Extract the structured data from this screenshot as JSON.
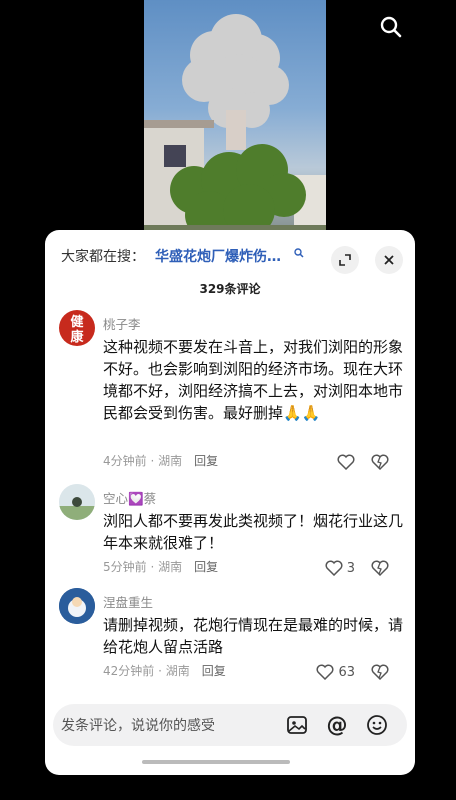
{
  "search_suggest": {
    "prefix": "大家都在搜：",
    "query": "华盛花炮厂爆炸伤…"
  },
  "comment_count": "329条评论",
  "comments": [
    {
      "user": "桃子李",
      "avatar_text": "健康",
      "text": "这种视频不要发在斗音上，对我们浏阳的形象不好。也会影响到浏阳的经济市场。现在大环境都不好，浏阳经济搞不上去，对浏阳本地市民都会受到伤害。最好删掉🙏🙏",
      "time": "4分钟前",
      "location": "湖南",
      "reply": "回复",
      "likes": ""
    },
    {
      "user": "空心💟蔡",
      "text": "浏阳人都不要再发此类视频了！烟花行业这几年本来就很难了！",
      "time": "5分钟前",
      "location": "湖南",
      "reply": "回复",
      "likes": "3"
    },
    {
      "user": "涅盘重生",
      "text": "请删掉视频，花炮行情现在是最难的时候，请给花炮人留点活路",
      "time": "42分钟前",
      "location": "湖南",
      "reply": "回复",
      "likes": "63"
    }
  ],
  "input": {
    "placeholder": "发条评论，说说你的感受"
  },
  "icons": [
    "search-icon",
    "collapse-icon",
    "close-icon",
    "heart-icon",
    "broken-heart-icon",
    "image-icon",
    "at-icon",
    "emoji-icon"
  ]
}
